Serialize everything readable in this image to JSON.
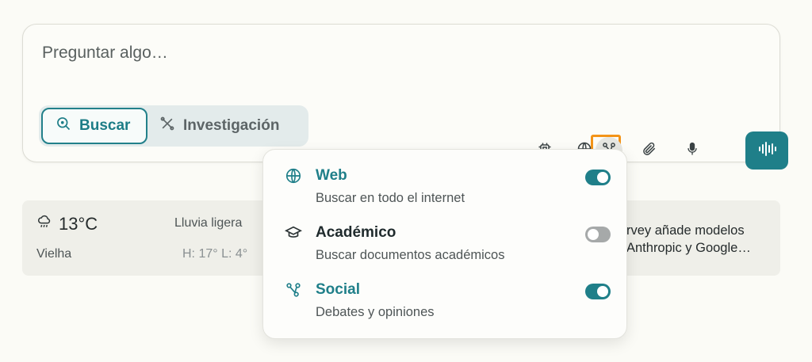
{
  "composer": {
    "placeholder": "Preguntar algo…",
    "modes": [
      {
        "label": "Buscar",
        "selected": true
      },
      {
        "label": "Investigación",
        "selected": false
      }
    ],
    "tools": [
      "chip-icon",
      "globe-icon",
      "connector-icon",
      "paperclip-icon",
      "microphone-icon",
      "audio-waveform-icon"
    ]
  },
  "weather": {
    "temperature": "13°C",
    "condition": "Lluvia ligera",
    "location": "Vielha",
    "high_low": "H: 17° L: 4°"
  },
  "news": {
    "text_line1": "rvey añade modelos",
    "text_line2": "Anthropic y Google…"
  },
  "sources_menu": {
    "options": [
      {
        "title": "Web",
        "description": "Buscar en todo el internet",
        "enabled": true,
        "icon": "globe-icon"
      },
      {
        "title": "Académico",
        "description": "Buscar documentos académicos",
        "enabled": false,
        "icon": "graduation-cap-icon"
      },
      {
        "title": "Social",
        "description": "Debates y opiniones",
        "enabled": true,
        "icon": "connector-icon"
      }
    ]
  },
  "colors": {
    "accent": "#1f7f89",
    "focus_ring": "#f39418",
    "background": "#fbfbf6"
  }
}
